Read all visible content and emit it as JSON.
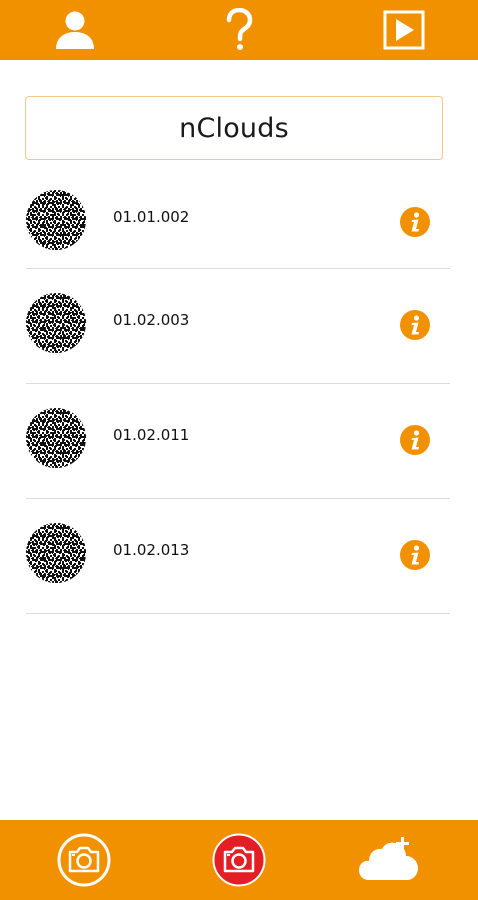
{
  "app": {
    "title": "nClouds",
    "accent_color": "#f19100",
    "record_color": "#e31e24"
  },
  "header": {
    "buttons": [
      {
        "icon": "user-icon"
      },
      {
        "icon": "help-icon"
      },
      {
        "icon": "play-video-icon"
      }
    ]
  },
  "items": [
    {
      "code": "01.01.002",
      "thumbnail": "qr-code-icon",
      "action_icon": "info-icon"
    },
    {
      "code": "01.02.003",
      "thumbnail": "qr-code-icon",
      "action_icon": "info-icon"
    },
    {
      "code": "01.02.011",
      "thumbnail": "qr-code-icon",
      "action_icon": "info-icon"
    },
    {
      "code": "01.02.013",
      "thumbnail": "qr-code-icon",
      "action_icon": "info-icon"
    }
  ],
  "footer": {
    "buttons": [
      {
        "icon": "camera-icon"
      },
      {
        "icon": "camera-record-icon"
      },
      {
        "icon": "cloud-add-icon"
      }
    ]
  }
}
